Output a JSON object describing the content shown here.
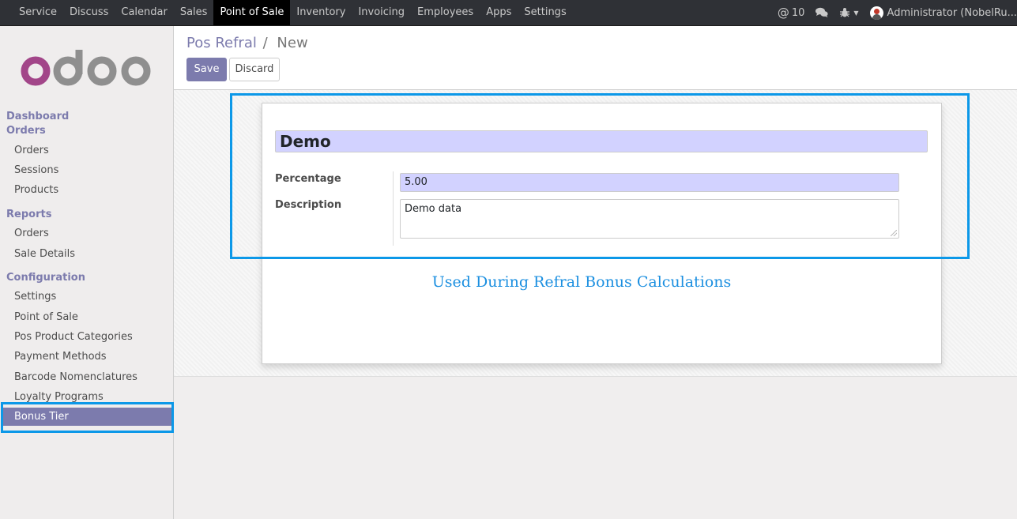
{
  "topbar": {
    "menu": [
      "Service",
      "Discuss",
      "Calendar",
      "Sales",
      "Point of Sale",
      "Inventory",
      "Invoicing",
      "Employees",
      "Apps",
      "Settings"
    ],
    "active_menu": "Point of Sale",
    "messages_count": "10",
    "user_name": "Administrator (NobelRu..."
  },
  "sidebar": {
    "logo_text": "odoo",
    "dashboard": "Dashboard",
    "orders_section": "Orders",
    "orders_items": [
      "Orders",
      "Sessions",
      "Products"
    ],
    "reports_section": "Reports",
    "reports_items": [
      "Orders",
      "Sale Details"
    ],
    "config_section": "Configuration",
    "config_items": [
      "Settings",
      "Point of Sale",
      "Pos Product Categories",
      "Payment Methods",
      "Barcode Nomenclatures",
      "Loyalty Programs",
      "Bonus Tier"
    ],
    "active_item": "Bonus Tier"
  },
  "control_panel": {
    "breadcrumb_parent": "Pos Refral",
    "breadcrumb_sep": "/",
    "breadcrumb_current": "New",
    "save_label": "Save",
    "discard_label": "Discard"
  },
  "form": {
    "name_value": "Demo",
    "percentage_label": "Percentage",
    "percentage_value": "5.00",
    "description_label": "Description",
    "description_value": "Demo data"
  },
  "annotation_text": "Used During Refral Bonus Calculations",
  "colors": {
    "accent": "#7c7bad",
    "highlight_box": "#0c98e8",
    "required_field_bg": "#d2d2ff",
    "topbar_bg": "#2f3136"
  }
}
